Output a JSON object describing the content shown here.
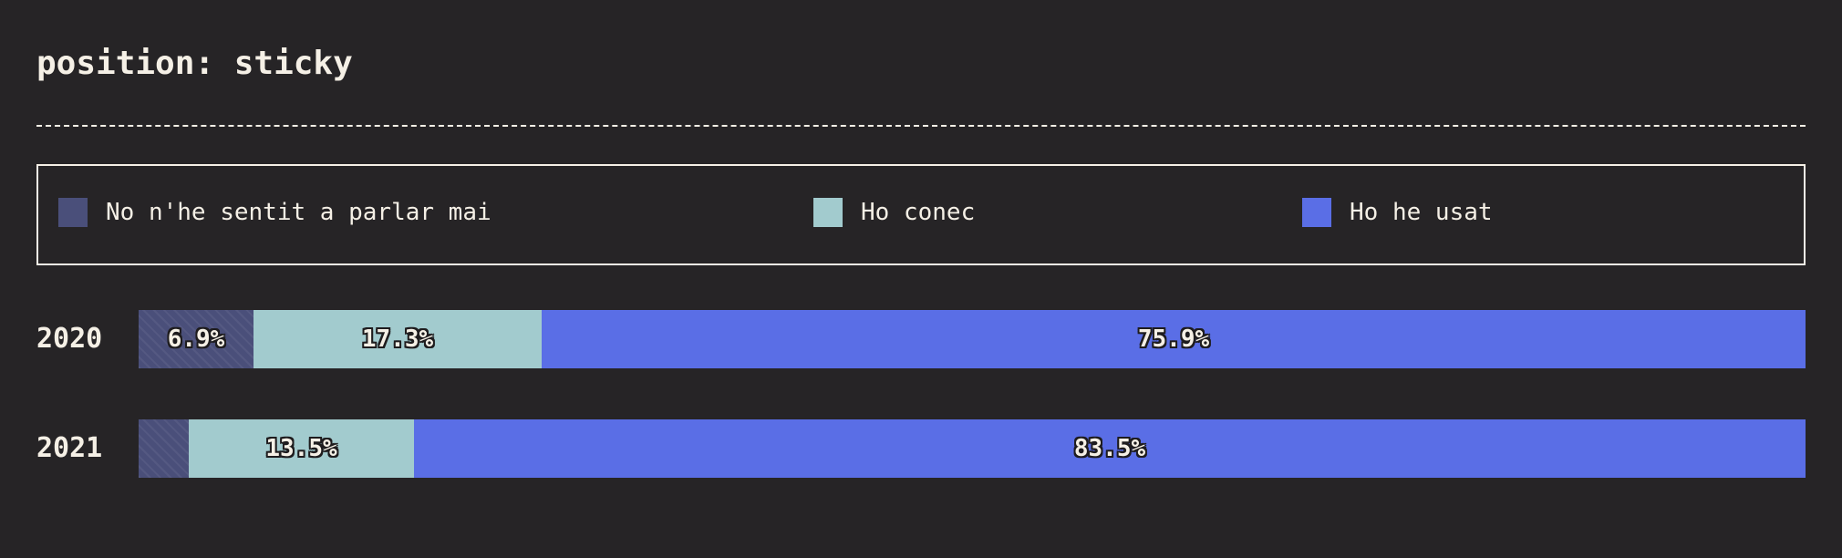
{
  "title": "position: sticky",
  "legend": [
    {
      "label": "No n'he sentit a parlar mai",
      "color": "#4a4f7a"
    },
    {
      "label": "Ho conec",
      "color": "#a2cbce"
    },
    {
      "label": "Ho he usat",
      "color": "#5a6ee6"
    }
  ],
  "chart_data": {
    "type": "bar",
    "orientation": "horizontal",
    "stacked": true,
    "normalized": true,
    "categories": [
      "2020",
      "2021"
    ],
    "series": [
      {
        "name": "No n'he sentit a parlar mai",
        "color": "#4a4f7a",
        "values": [
          6.9,
          3.0
        ],
        "labels": [
          "6.9%",
          ""
        ]
      },
      {
        "name": "Ho conec",
        "color": "#a2cbce",
        "values": [
          17.3,
          13.5
        ],
        "labels": [
          "17.3%",
          "13.5%"
        ]
      },
      {
        "name": "Ho he usat",
        "color": "#5a6ee6",
        "values": [
          75.9,
          83.5
        ],
        "labels": [
          "75.9%",
          "83.5%"
        ]
      }
    ],
    "xlim": [
      0,
      100
    ],
    "grid": false,
    "legend_position": "top"
  }
}
